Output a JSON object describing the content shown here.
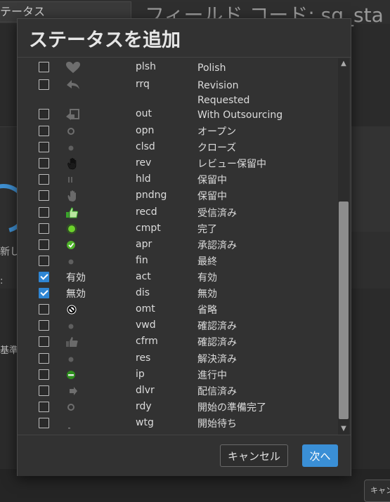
{
  "background": {
    "tab_label": "テータス",
    "page_title": "フィールド コード: sg_sta",
    "left_text_new": "新し",
    "left_text_colon": ":",
    "left_text_base": "基準",
    "bottom_button": "キャンセ"
  },
  "dialog": {
    "title": "ステータスを追加",
    "rows": [
      {
        "checked": false,
        "icon": "heart-icon",
        "icon_label": "",
        "code": "plsh",
        "name": "Polish"
      },
      {
        "checked": false,
        "icon": "reply-arrow-icon",
        "icon_label": "",
        "code": "rrq",
        "name": "Revision\nRequested"
      },
      {
        "checked": false,
        "icon": "outsource-icon",
        "icon_label": "",
        "code": "out",
        "name": "With Outsourcing"
      },
      {
        "checked": false,
        "icon": "ring-icon",
        "icon_label": "",
        "code": "opn",
        "name": "オープン"
      },
      {
        "checked": false,
        "icon": "dot-icon",
        "icon_label": "",
        "code": "clsd",
        "name": "クローズ"
      },
      {
        "checked": false,
        "icon": "hand-icon",
        "icon_label": "",
        "code": "rev",
        "name": "レビュー保留中"
      },
      {
        "checked": false,
        "icon": "pause-icon",
        "icon_label": "",
        "code": "hld",
        "name": "保留中"
      },
      {
        "checked": false,
        "icon": "gray-hand-icon",
        "icon_label": "",
        "code": "pndng",
        "name": "保留中"
      },
      {
        "checked": false,
        "icon": "thumbs-up-green-icon",
        "icon_label": "",
        "code": "recd",
        "name": "受信済み"
      },
      {
        "checked": false,
        "icon": "green-dot-icon",
        "icon_label": "",
        "code": "cmpt",
        "name": "完了"
      },
      {
        "checked": false,
        "icon": "green-check-icon",
        "icon_label": "",
        "code": "apr",
        "name": "承認済み"
      },
      {
        "checked": false,
        "icon": "dot-icon",
        "icon_label": "",
        "code": "fin",
        "name": "最終"
      },
      {
        "checked": true,
        "icon": "",
        "icon_label": "有効",
        "code": "act",
        "name": "有効"
      },
      {
        "checked": true,
        "icon": "",
        "icon_label": "無効",
        "code": "dis",
        "name": "無効"
      },
      {
        "checked": false,
        "icon": "prohibited-icon",
        "icon_label": "",
        "code": "omt",
        "name": "省略"
      },
      {
        "checked": false,
        "icon": "dot-icon",
        "icon_label": "",
        "code": "vwd",
        "name": "確認済み"
      },
      {
        "checked": false,
        "icon": "thumbs-up-gray-icon",
        "icon_label": "",
        "code": "cfrm",
        "name": "確認済み"
      },
      {
        "checked": false,
        "icon": "dot-icon",
        "icon_label": "",
        "code": "res",
        "name": "解決済み"
      },
      {
        "checked": false,
        "icon": "in-progress-icon",
        "icon_label": "",
        "code": "ip",
        "name": "進行中"
      },
      {
        "checked": false,
        "icon": "deliver-arrow-icon",
        "icon_label": "",
        "code": "dlvr",
        "name": "配信済み"
      },
      {
        "checked": false,
        "icon": "ring-icon",
        "icon_label": "",
        "code": "rdy",
        "name": "開始の準備完了"
      },
      {
        "checked": false,
        "icon": "dash-icon",
        "icon_label": "",
        "code": "wtg",
        "name": "開始待ち"
      }
    ],
    "cancel_label": "キャンセル",
    "next_label": "次へ"
  },
  "colors": {
    "accent": "#3a8fd6",
    "checkbox_checked": "#2f86d4",
    "green_status": "#6bd12a"
  }
}
